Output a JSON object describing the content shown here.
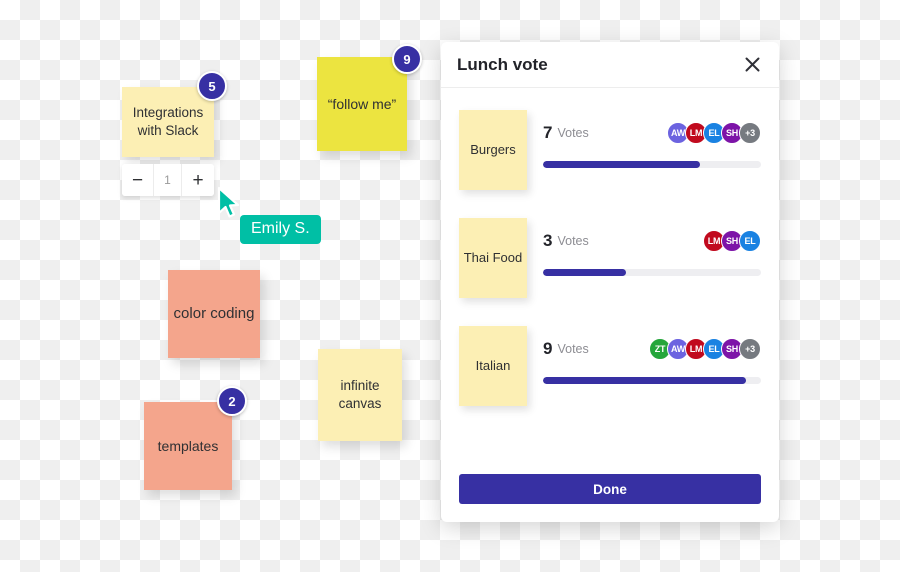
{
  "board": {
    "notes": [
      {
        "id": "integrations",
        "text": "Integrations with Slack",
        "color": "#fcefb4",
        "badge": "5"
      },
      {
        "id": "followme",
        "text": "“follow me”",
        "color": "#ece440",
        "badge": "9"
      },
      {
        "id": "color",
        "text": "color coding",
        "color": "#f4a58c",
        "badge": ""
      },
      {
        "id": "templates",
        "text": "templates",
        "color": "#f4a58c",
        "badge": "2"
      },
      {
        "id": "infinite",
        "text": "infinite canvas",
        "color": "#fcefb4",
        "badge": ""
      }
    ],
    "stepper": {
      "decrement_label": "−",
      "value": "1",
      "increment_label": "+"
    },
    "cursor": {
      "name": "Emily S.",
      "color": "#00bfa5",
      "icon": "pointer-cursor-icon"
    },
    "badge_color": "#3730a3"
  },
  "modal": {
    "title": "Lunch vote",
    "close_icon": "close-icon",
    "done_label": "Done",
    "accent_color": "#3730a3",
    "votes_word": "Votes",
    "options": [
      {
        "label": "Burgers",
        "count": "7",
        "percent": 72,
        "avatars": [
          {
            "initials": "AW",
            "color": "#6c63e0"
          },
          {
            "initials": "LM",
            "color": "#c10a1e"
          },
          {
            "initials": "EL",
            "color": "#1a82e2"
          },
          {
            "initials": "SH",
            "color": "#7d14a8"
          },
          {
            "initials": "+3",
            "color": "#767a80"
          }
        ]
      },
      {
        "label": "Thai Food",
        "count": "3",
        "percent": 38,
        "avatars": [
          {
            "initials": "LM",
            "color": "#c10a1e"
          },
          {
            "initials": "SH",
            "color": "#7d14a8"
          },
          {
            "initials": "EL",
            "color": "#1a82e2"
          }
        ]
      },
      {
        "label": "Italian",
        "count": "9",
        "percent": 93,
        "avatars": [
          {
            "initials": "ZT",
            "color": "#25a63b"
          },
          {
            "initials": "AW",
            "color": "#6c63e0"
          },
          {
            "initials": "LM",
            "color": "#c10a1e"
          },
          {
            "initials": "EL",
            "color": "#1a82e2"
          },
          {
            "initials": "SH",
            "color": "#7d14a8"
          },
          {
            "initials": "+3",
            "color": "#767a80"
          }
        ]
      }
    ]
  }
}
